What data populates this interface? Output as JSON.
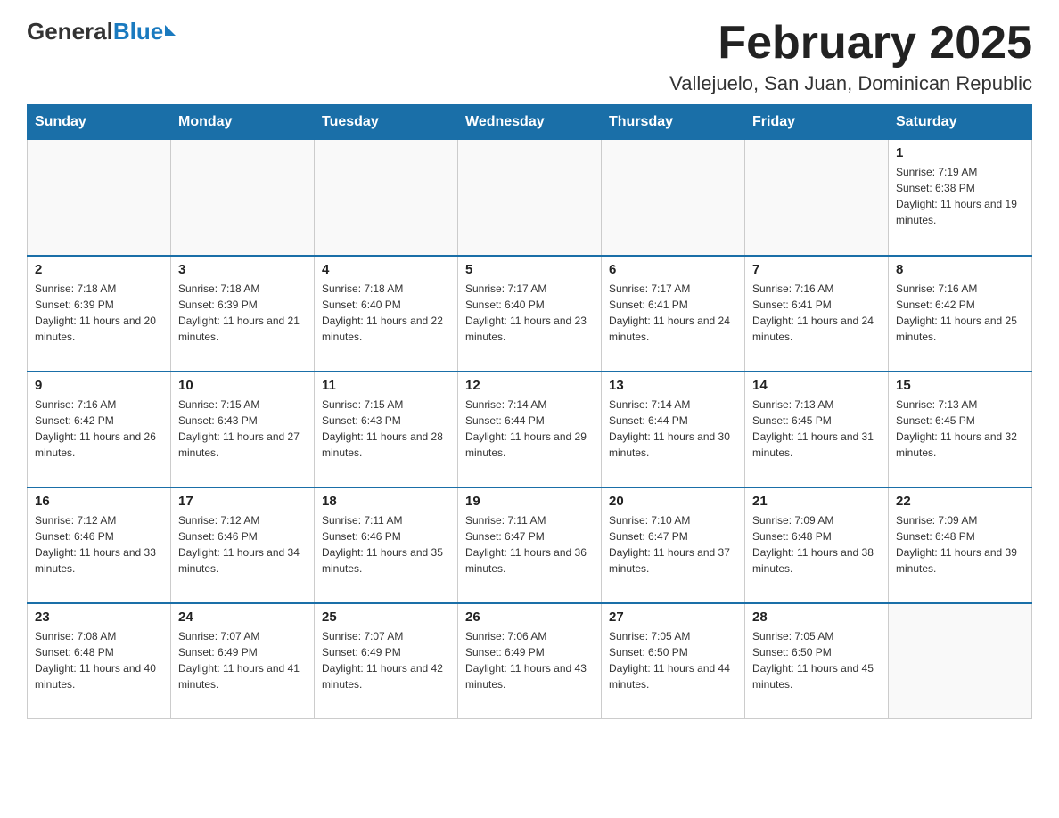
{
  "header": {
    "logo_general": "General",
    "logo_blue": "Blue",
    "month_title": "February 2025",
    "location": "Vallejuelo, San Juan, Dominican Republic"
  },
  "weekdays": [
    "Sunday",
    "Monday",
    "Tuesday",
    "Wednesday",
    "Thursday",
    "Friday",
    "Saturday"
  ],
  "weeks": [
    [
      {
        "day": "",
        "info": ""
      },
      {
        "day": "",
        "info": ""
      },
      {
        "day": "",
        "info": ""
      },
      {
        "day": "",
        "info": ""
      },
      {
        "day": "",
        "info": ""
      },
      {
        "day": "",
        "info": ""
      },
      {
        "day": "1",
        "info": "Sunrise: 7:19 AM\nSunset: 6:38 PM\nDaylight: 11 hours and 19 minutes."
      }
    ],
    [
      {
        "day": "2",
        "info": "Sunrise: 7:18 AM\nSunset: 6:39 PM\nDaylight: 11 hours and 20 minutes."
      },
      {
        "day": "3",
        "info": "Sunrise: 7:18 AM\nSunset: 6:39 PM\nDaylight: 11 hours and 21 minutes."
      },
      {
        "day": "4",
        "info": "Sunrise: 7:18 AM\nSunset: 6:40 PM\nDaylight: 11 hours and 22 minutes."
      },
      {
        "day": "5",
        "info": "Sunrise: 7:17 AM\nSunset: 6:40 PM\nDaylight: 11 hours and 23 minutes."
      },
      {
        "day": "6",
        "info": "Sunrise: 7:17 AM\nSunset: 6:41 PM\nDaylight: 11 hours and 24 minutes."
      },
      {
        "day": "7",
        "info": "Sunrise: 7:16 AM\nSunset: 6:41 PM\nDaylight: 11 hours and 24 minutes."
      },
      {
        "day": "8",
        "info": "Sunrise: 7:16 AM\nSunset: 6:42 PM\nDaylight: 11 hours and 25 minutes."
      }
    ],
    [
      {
        "day": "9",
        "info": "Sunrise: 7:16 AM\nSunset: 6:42 PM\nDaylight: 11 hours and 26 minutes."
      },
      {
        "day": "10",
        "info": "Sunrise: 7:15 AM\nSunset: 6:43 PM\nDaylight: 11 hours and 27 minutes."
      },
      {
        "day": "11",
        "info": "Sunrise: 7:15 AM\nSunset: 6:43 PM\nDaylight: 11 hours and 28 minutes."
      },
      {
        "day": "12",
        "info": "Sunrise: 7:14 AM\nSunset: 6:44 PM\nDaylight: 11 hours and 29 minutes."
      },
      {
        "day": "13",
        "info": "Sunrise: 7:14 AM\nSunset: 6:44 PM\nDaylight: 11 hours and 30 minutes."
      },
      {
        "day": "14",
        "info": "Sunrise: 7:13 AM\nSunset: 6:45 PM\nDaylight: 11 hours and 31 minutes."
      },
      {
        "day": "15",
        "info": "Sunrise: 7:13 AM\nSunset: 6:45 PM\nDaylight: 11 hours and 32 minutes."
      }
    ],
    [
      {
        "day": "16",
        "info": "Sunrise: 7:12 AM\nSunset: 6:46 PM\nDaylight: 11 hours and 33 minutes."
      },
      {
        "day": "17",
        "info": "Sunrise: 7:12 AM\nSunset: 6:46 PM\nDaylight: 11 hours and 34 minutes."
      },
      {
        "day": "18",
        "info": "Sunrise: 7:11 AM\nSunset: 6:46 PM\nDaylight: 11 hours and 35 minutes."
      },
      {
        "day": "19",
        "info": "Sunrise: 7:11 AM\nSunset: 6:47 PM\nDaylight: 11 hours and 36 minutes."
      },
      {
        "day": "20",
        "info": "Sunrise: 7:10 AM\nSunset: 6:47 PM\nDaylight: 11 hours and 37 minutes."
      },
      {
        "day": "21",
        "info": "Sunrise: 7:09 AM\nSunset: 6:48 PM\nDaylight: 11 hours and 38 minutes."
      },
      {
        "day": "22",
        "info": "Sunrise: 7:09 AM\nSunset: 6:48 PM\nDaylight: 11 hours and 39 minutes."
      }
    ],
    [
      {
        "day": "23",
        "info": "Sunrise: 7:08 AM\nSunset: 6:48 PM\nDaylight: 11 hours and 40 minutes."
      },
      {
        "day": "24",
        "info": "Sunrise: 7:07 AM\nSunset: 6:49 PM\nDaylight: 11 hours and 41 minutes."
      },
      {
        "day": "25",
        "info": "Sunrise: 7:07 AM\nSunset: 6:49 PM\nDaylight: 11 hours and 42 minutes."
      },
      {
        "day": "26",
        "info": "Sunrise: 7:06 AM\nSunset: 6:49 PM\nDaylight: 11 hours and 43 minutes."
      },
      {
        "day": "27",
        "info": "Sunrise: 7:05 AM\nSunset: 6:50 PM\nDaylight: 11 hours and 44 minutes."
      },
      {
        "day": "28",
        "info": "Sunrise: 7:05 AM\nSunset: 6:50 PM\nDaylight: 11 hours and 45 minutes."
      },
      {
        "day": "",
        "info": ""
      }
    ]
  ]
}
